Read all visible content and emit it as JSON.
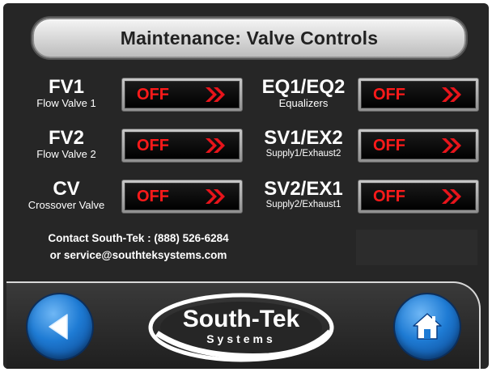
{
  "header": {
    "title": "Maintenance: Valve Controls"
  },
  "valves": [
    {
      "code": "FV1",
      "desc": "Flow Valve 1",
      "state": "OFF"
    },
    {
      "code": "FV2",
      "desc": "Flow Valve 2",
      "state": "OFF"
    },
    {
      "code": "CV",
      "desc": "Crossover Valve",
      "state": "OFF"
    },
    {
      "code": "EQ1/EQ2",
      "desc": "Equalizers",
      "state": "OFF"
    },
    {
      "code": "SV1/EX2",
      "desc": "Supply1/Exhaust2",
      "state": "OFF"
    },
    {
      "code": "SV2/EX1",
      "desc": "Supply2/Exhaust1",
      "state": "OFF"
    }
  ],
  "contact": {
    "line1": "Contact South-Tek : (888) 526-6284",
    "line2": "or service@southteksystems.com"
  },
  "logo": {
    "name": "South-Tek",
    "sub": "Systems"
  },
  "nav": {
    "back_icon": "back-arrow-icon",
    "home_icon": "home-icon"
  },
  "colors": {
    "background": "#262626",
    "state_off": "#ff1a1a",
    "arrow": "#e8141b",
    "nav_blue": "#1e7bd4"
  }
}
